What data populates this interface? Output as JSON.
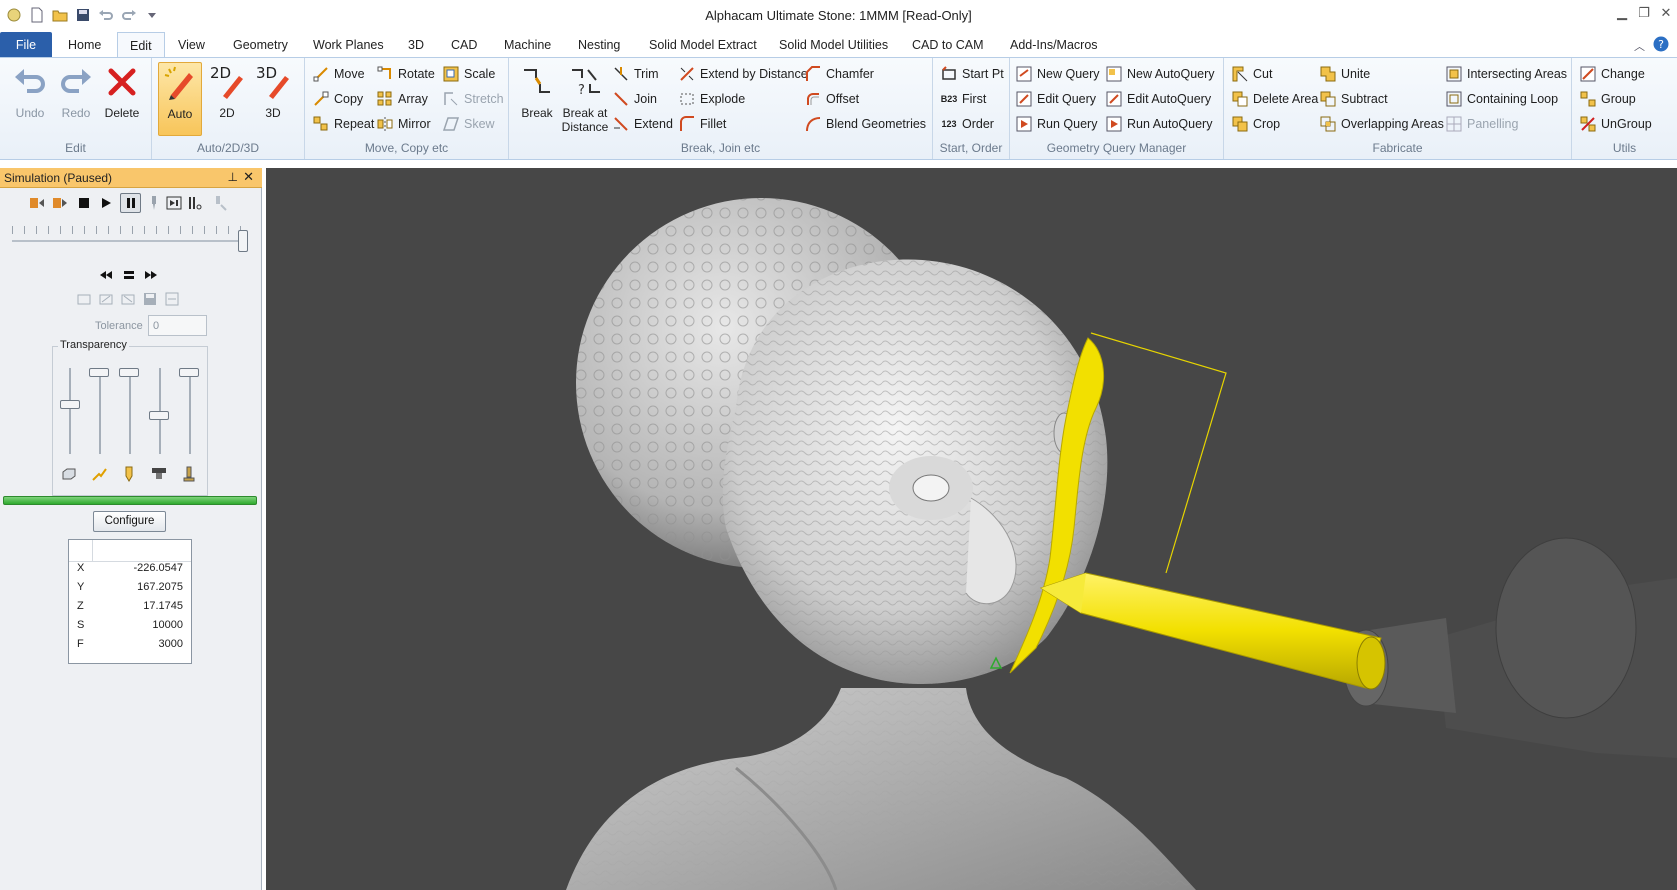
{
  "window": {
    "title": "Alphacam Ultimate Stone: 1MMM [Read-Only]"
  },
  "tabs": [
    "File",
    "Home",
    "Edit",
    "View",
    "Geometry",
    "Work Planes",
    "3D",
    "CAD",
    "Machine",
    "Nesting",
    "Solid Model Extract",
    "Solid Model Utilities",
    "CAD to CAM",
    "Add-Ins/Macros"
  ],
  "active_tab": "Edit",
  "ribbon": {
    "edit": {
      "label": "Edit",
      "undo": "Undo",
      "redo": "Redo",
      "delete": "Delete"
    },
    "auto": {
      "label": "Auto/2D/3D",
      "auto": "Auto",
      "two_d": "2D",
      "three_d": "3D",
      "icon_2d": "2D",
      "icon_3d": "3D"
    },
    "move": {
      "label": "Move, Copy etc",
      "move": "Move",
      "copy": "Copy",
      "repeat": "Repeat",
      "rotate": "Rotate",
      "array": "Array",
      "mirror": "Mirror",
      "scale": "Scale",
      "stretch": "Stretch",
      "skew": "Skew"
    },
    "break": {
      "label": "Break, Join etc",
      "break": "Break",
      "break_at_1": "Break at",
      "break_at_2": "Distance",
      "trim": "Trim",
      "join": "Join",
      "extend": "Extend",
      "extend_by_distance": "Extend by Distance",
      "explode": "Explode",
      "fillet": "Fillet",
      "chamfer": "Chamfer",
      "offset": "Offset",
      "blend": "Blend Geometries"
    },
    "start": {
      "label": "Start, Order",
      "start_pt": "Start Pt",
      "first": "First",
      "order": "Order",
      "first_icon": "B23",
      "order_icon": "123"
    },
    "query": {
      "label": "Geometry Query Manager",
      "new_query": "New Query",
      "edit_query": "Edit Query",
      "run_query": "Run Query",
      "new_auto": "New AutoQuery",
      "edit_auto": "Edit AutoQuery",
      "run_auto": "Run AutoQuery"
    },
    "fabricate": {
      "label": "Fabricate",
      "cut": "Cut",
      "delete_area": "Delete Area",
      "crop": "Crop",
      "unite": "Unite",
      "subtract": "Subtract",
      "overlapping": "Overlapping Areas",
      "intersecting": "Intersecting Areas",
      "containing": "Containing Loop",
      "panelling": "Panelling"
    },
    "utils": {
      "label": "Utils",
      "change": "Change",
      "group": "Group",
      "ungroup": "UnGroup"
    }
  },
  "simulation_panel": {
    "title": "Simulation (Paused)",
    "tolerance_label": "Tolerance",
    "tolerance_value": "0",
    "transparency_label": "Transparency",
    "playback_position": 1.0,
    "progress": 1.0,
    "configure_label": "Configure",
    "coords": [
      {
        "key": "X",
        "value": "-226.0547"
      },
      {
        "key": "Y",
        "value": "167.2075"
      },
      {
        "key": "Z",
        "value": "17.1745"
      },
      {
        "key": "S",
        "value": "10000"
      },
      {
        "key": "F",
        "value": "3000"
      }
    ]
  },
  "colors": {
    "accent_file_tab": "#2b5faa",
    "panel_header": "#f9c66b",
    "viewport_bg": "#474747",
    "toolpath": "#f2e000",
    "progress": "#2faa2f"
  }
}
